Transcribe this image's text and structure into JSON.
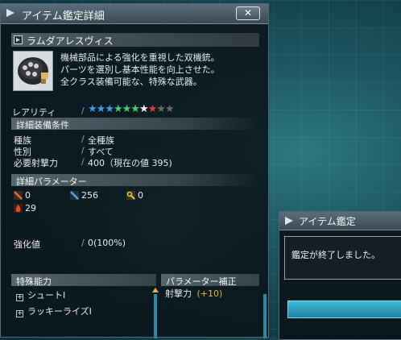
{
  "window": {
    "title": "アイテム鑑定詳細",
    "close_label": "✕"
  },
  "item": {
    "name": "ラムダアレスヴィス",
    "description": [
      "機械部品による強化を重視した双機銃。",
      "パーツを選別し基本性能を向上させた。",
      "全クラス装備可能な、特殊な武器。"
    ]
  },
  "rarity": {
    "label": "レアリティ",
    "value": 9,
    "max": 13,
    "star_colors": [
      "#3aa0e8",
      "#3aa0e8",
      "#3aa0e8",
      "#3fd26a",
      "#3fd26a",
      "#3fd26a",
      "#ffffff",
      "#e83a2a",
      "#6a6a6a",
      "#6a6a6a"
    ]
  },
  "equip_conditions": {
    "header": "詳細装備条件",
    "rows": [
      {
        "label": "種族",
        "value": "全種族"
      },
      {
        "label": "性別",
        "value": "すべて"
      },
      {
        "label": "必要射撃力",
        "value": "400（現在の値 395)"
      }
    ]
  },
  "parameters": {
    "header": "詳細パラメーター",
    "atk_melee": "0",
    "atk_ranged": "256",
    "atk_tech": "0",
    "element": "29"
  },
  "grind": {
    "label": "強化値",
    "value": "0(100%)"
  },
  "special_abilities": {
    "header": "特殊能力",
    "items": [
      "シュートⅠ",
      "ラッキーライズⅠ"
    ]
  },
  "param_bonus": {
    "header": "パラメーター補正",
    "label": "射撃力",
    "value": "(+10)"
  },
  "dialog": {
    "title": "アイテム鑑定",
    "message": "鑑定が終了しました。"
  }
}
